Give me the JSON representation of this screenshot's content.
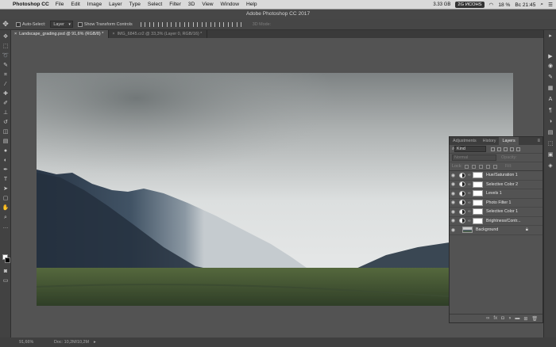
{
  "menubar": {
    "app_name": "Photoshop CC",
    "items": [
      "File",
      "Edit",
      "Image",
      "Layer",
      "Type",
      "Select",
      "Filter",
      "3D",
      "View",
      "Window",
      "Help"
    ],
    "memory": "3.33 GB",
    "cpu_badge": "2G ИСОНS",
    "battery": "18 %",
    "clock": "Вс 21:45"
  },
  "window": {
    "title": "Adobe Photoshop CC 2017"
  },
  "options_bar": {
    "auto_select_label": "Auto-Select:",
    "auto_select_value": "Layer",
    "show_transform_label": "Show Transform Controls",
    "mode_3d_label": "3D Mode:"
  },
  "doc_tabs": [
    {
      "label": "Landscape_grading.psd @ 91,6% (RGB/8) *",
      "active": true
    },
    {
      "label": "IMG_6845.cr2 @ 33,3% (Layer 0, RGB/16) *",
      "active": false
    }
  ],
  "status_bar": {
    "zoom": "91,66%",
    "doc_size": "Doc: 10,2M/10,2M"
  },
  "layers_panel": {
    "tabs": [
      "Adjustments",
      "History",
      "Layers"
    ],
    "active_tab": "Layers",
    "filter_kind": "Kind",
    "blend_mode": "Normal",
    "opacity_label": "Opacity:",
    "lock_label": "Lock:",
    "fill_label": "Fill:",
    "layers": [
      {
        "name": "Hue/Saturation 1"
      },
      {
        "name": "Selective Color 2"
      },
      {
        "name": "Levels 1"
      },
      {
        "name": "Photo Filter 1"
      },
      {
        "name": "Selective Color 1"
      },
      {
        "name": "Brightness/Contr..."
      }
    ],
    "background_layer": "Background"
  }
}
